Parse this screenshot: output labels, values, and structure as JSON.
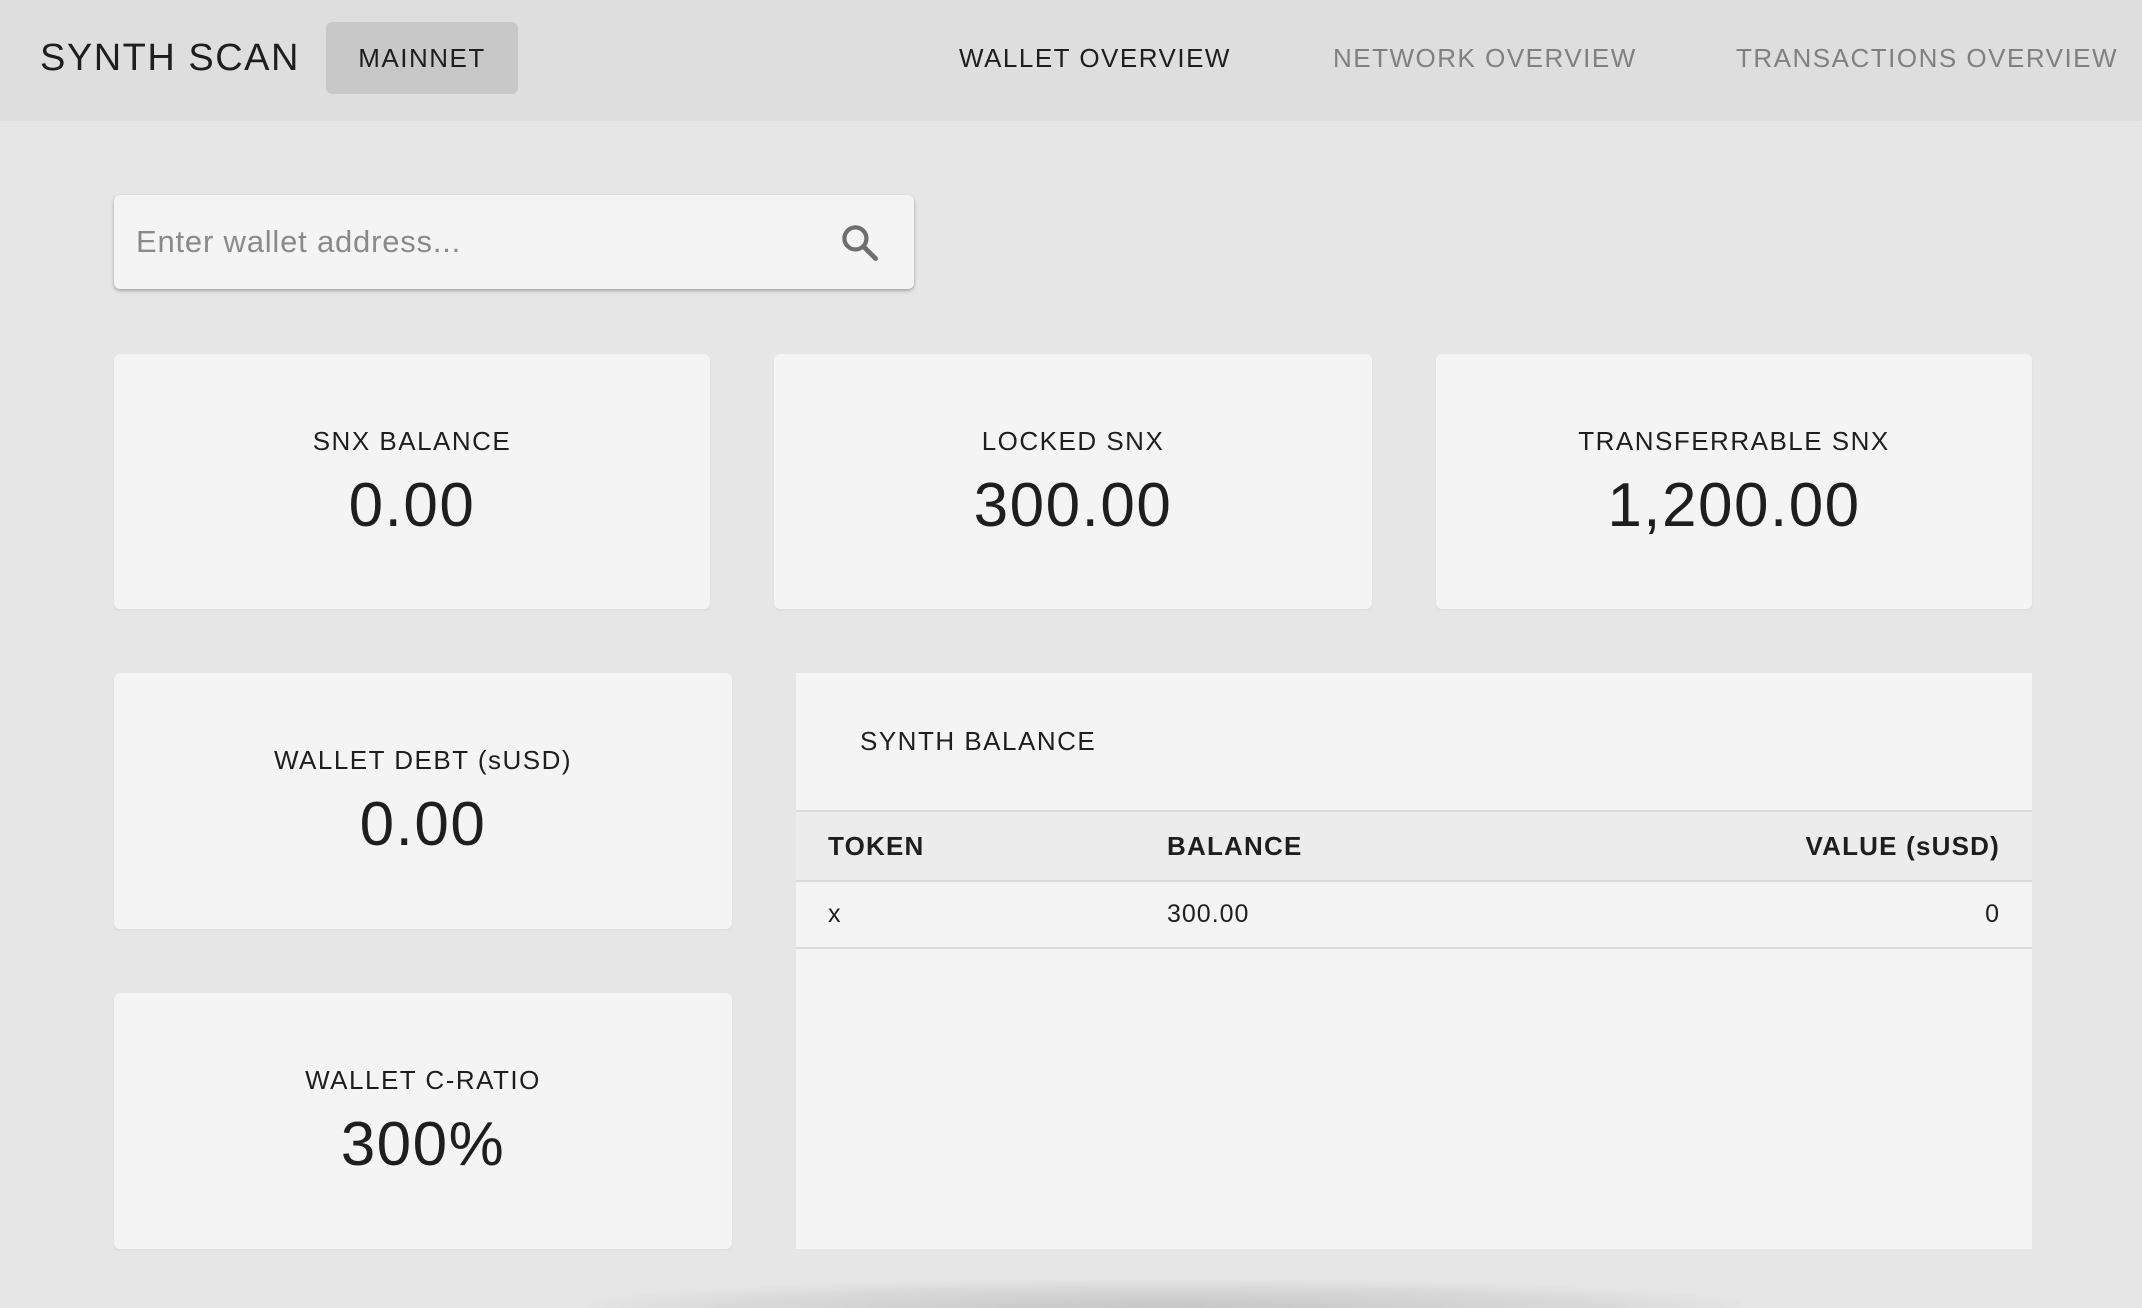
{
  "header": {
    "brand": "SYNTH SCAN",
    "network_button": "MAINNET",
    "nav": {
      "wallet": "WALLET OVERVIEW",
      "network": "NETWORK OVERVIEW",
      "transactions": "TRANSACTIONS OVERVIEW"
    }
  },
  "search": {
    "placeholder": "Enter wallet address...",
    "value": "",
    "icon": "search-icon"
  },
  "cards": {
    "snx_balance": {
      "label": "SNX BALANCE",
      "value": "0.00"
    },
    "locked_snx": {
      "label": "LOCKED SNX",
      "value": "300.00"
    },
    "transferrable_snx": {
      "label": "TRANSFERRABLE SNX",
      "value": "1,200.00"
    },
    "wallet_debt": {
      "label": "WALLET DEBT (sUSD)",
      "value": "0.00"
    },
    "wallet_cratio": {
      "label": "WALLET C-RATIO",
      "value": "300%"
    }
  },
  "synth_balance": {
    "title": "SYNTH BALANCE",
    "columns": {
      "token": "TOKEN",
      "balance": "BALANCE",
      "value": "VALUE (sUSD)"
    },
    "rows": [
      {
        "token": "x",
        "balance": "300.00",
        "value": "0"
      }
    ]
  },
  "colors": {
    "page_background": "#e6e6e6",
    "header_background": "#dedede",
    "card_background": "#f4f4f4",
    "network_button": "#c8c8c8",
    "text_primary": "#1e1e1e",
    "text_muted": "#808080"
  }
}
